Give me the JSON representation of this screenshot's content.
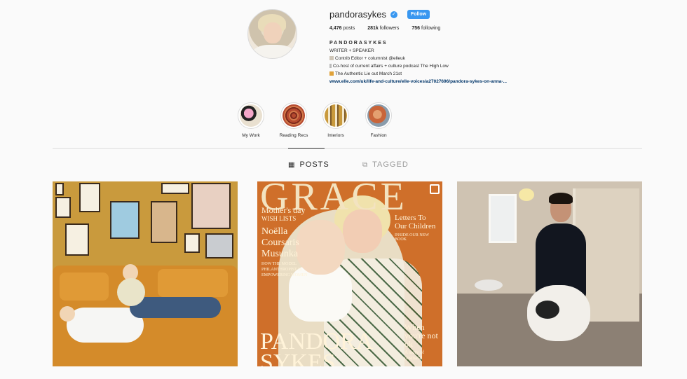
{
  "profile": {
    "username": "pandorasykes",
    "follow_label": "Follow",
    "stats": [
      {
        "value": "4,476",
        "label": "posts"
      },
      {
        "value": "281k",
        "label": "followers"
      },
      {
        "value": "756",
        "label": "following"
      }
    ],
    "bio": {
      "name": "PANDORASYKES",
      "line1": "WRITER + SPEAKER",
      "line2": "Contrib Editor + columnist @elleuk",
      "line3": "Co-host of current affairs + culture podcast The High Low",
      "line4": "The Authentic Lie out March 21st",
      "link": "www.elle.com/uk/life-and-culture/elle-voices/a27027696/pandora-sykes-on-anna-..."
    }
  },
  "highlights": [
    {
      "label": "My Work"
    },
    {
      "label": "Reading Recs"
    },
    {
      "label": "Interiors"
    },
    {
      "label": "Fashion"
    }
  ],
  "tabs": {
    "posts": "POSTS",
    "tagged": "TAGGED"
  },
  "cover": {
    "masthead": "GRACE",
    "left1": "Mother's day",
    "left2": "WISH LISTS",
    "left3": "Noëlla",
    "left4": "Coursaris",
    "left5": "Musunka",
    "left6": "HOW THE MODEL PHILANTHROPIST IS EMPOWERING WOMEN",
    "right1": "Letters To Our Children",
    "right2": "INSIDE OUR NEW BOOK",
    "bottom_name": "PANDORA SYKES",
    "bottom_right": "When you're not ok",
    "bottom_right2": "A story of postnatal"
  }
}
